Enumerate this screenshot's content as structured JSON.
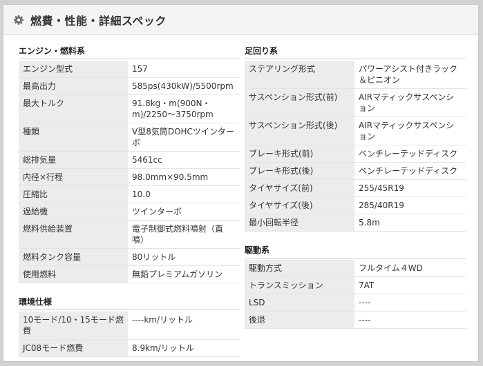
{
  "title": "燃費・性能・詳細スペック",
  "engine": {
    "section_title": "エンジン・燃料系",
    "rows": [
      {
        "label": "エンジン型式",
        "value": "157"
      },
      {
        "label": "最高出力",
        "value": "585ps(430kW)/5500rpm"
      },
      {
        "label": "最大トルク",
        "value": "91.8kg・m(900N・m)/2250〜3750rpm"
      },
      {
        "label": "種類",
        "value": "V型8気筒DOHCツインターボ"
      },
      {
        "label": "総排気量",
        "value": "5461cc"
      },
      {
        "label": "内径×行程",
        "value": "98.0mm×90.5mm"
      },
      {
        "label": "圧縮比",
        "value": "10.0"
      },
      {
        "label": "過給機",
        "value": "ツインターボ"
      },
      {
        "label": "燃料供給装置",
        "value": "電子制御式燃料噴射（直噴）"
      },
      {
        "label": "燃料タンク容量",
        "value": "80リットル"
      },
      {
        "label": "使用燃料",
        "value": "無鉛プレミアムガソリン"
      }
    ]
  },
  "environment": {
    "section_title": "環境仕様",
    "rows": [
      {
        "label": "10モード/10・15モード燃費",
        "value": "----km/リットル"
      },
      {
        "label": "JC08モード燃費",
        "value": "8.9km/リットル"
      }
    ]
  },
  "suspension": {
    "section_title": "足回り系",
    "rows": [
      {
        "label": "ステアリング形式",
        "value": "パワーアシスト付きラック＆ピニオン"
      },
      {
        "label": "サスペンション形式(前)",
        "value": "AIRマティックサスペンション"
      },
      {
        "label": "サスペンション形式(後)",
        "value": "AIRマティックサスペンション"
      },
      {
        "label": "ブレーキ形式(前)",
        "value": "ベンチレーテッドディスク"
      },
      {
        "label": "ブレーキ形式(後)",
        "value": "ベンチレーテッドディスク"
      },
      {
        "label": "タイヤサイズ(前)",
        "value": "255/45R19"
      },
      {
        "label": "タイヤサイズ(後)",
        "value": "285/40R19"
      },
      {
        "label": "最小回転半径",
        "value": "5.8m"
      }
    ]
  },
  "drivetrain": {
    "section_title": "駆動系",
    "rows": [
      {
        "label": "駆動方式",
        "value": "フルタイム４WD"
      },
      {
        "label": "トランスミッション",
        "value": "7AT"
      },
      {
        "label": "LSD",
        "value": "----"
      },
      {
        "label": "後退",
        "value": "----"
      }
    ]
  },
  "icons": {
    "header": "gear-icon"
  },
  "colors": {
    "key_bg": "#ececec",
    "panel_bg": "#f4f4f4",
    "outer_bg": "#d2d2d2"
  }
}
